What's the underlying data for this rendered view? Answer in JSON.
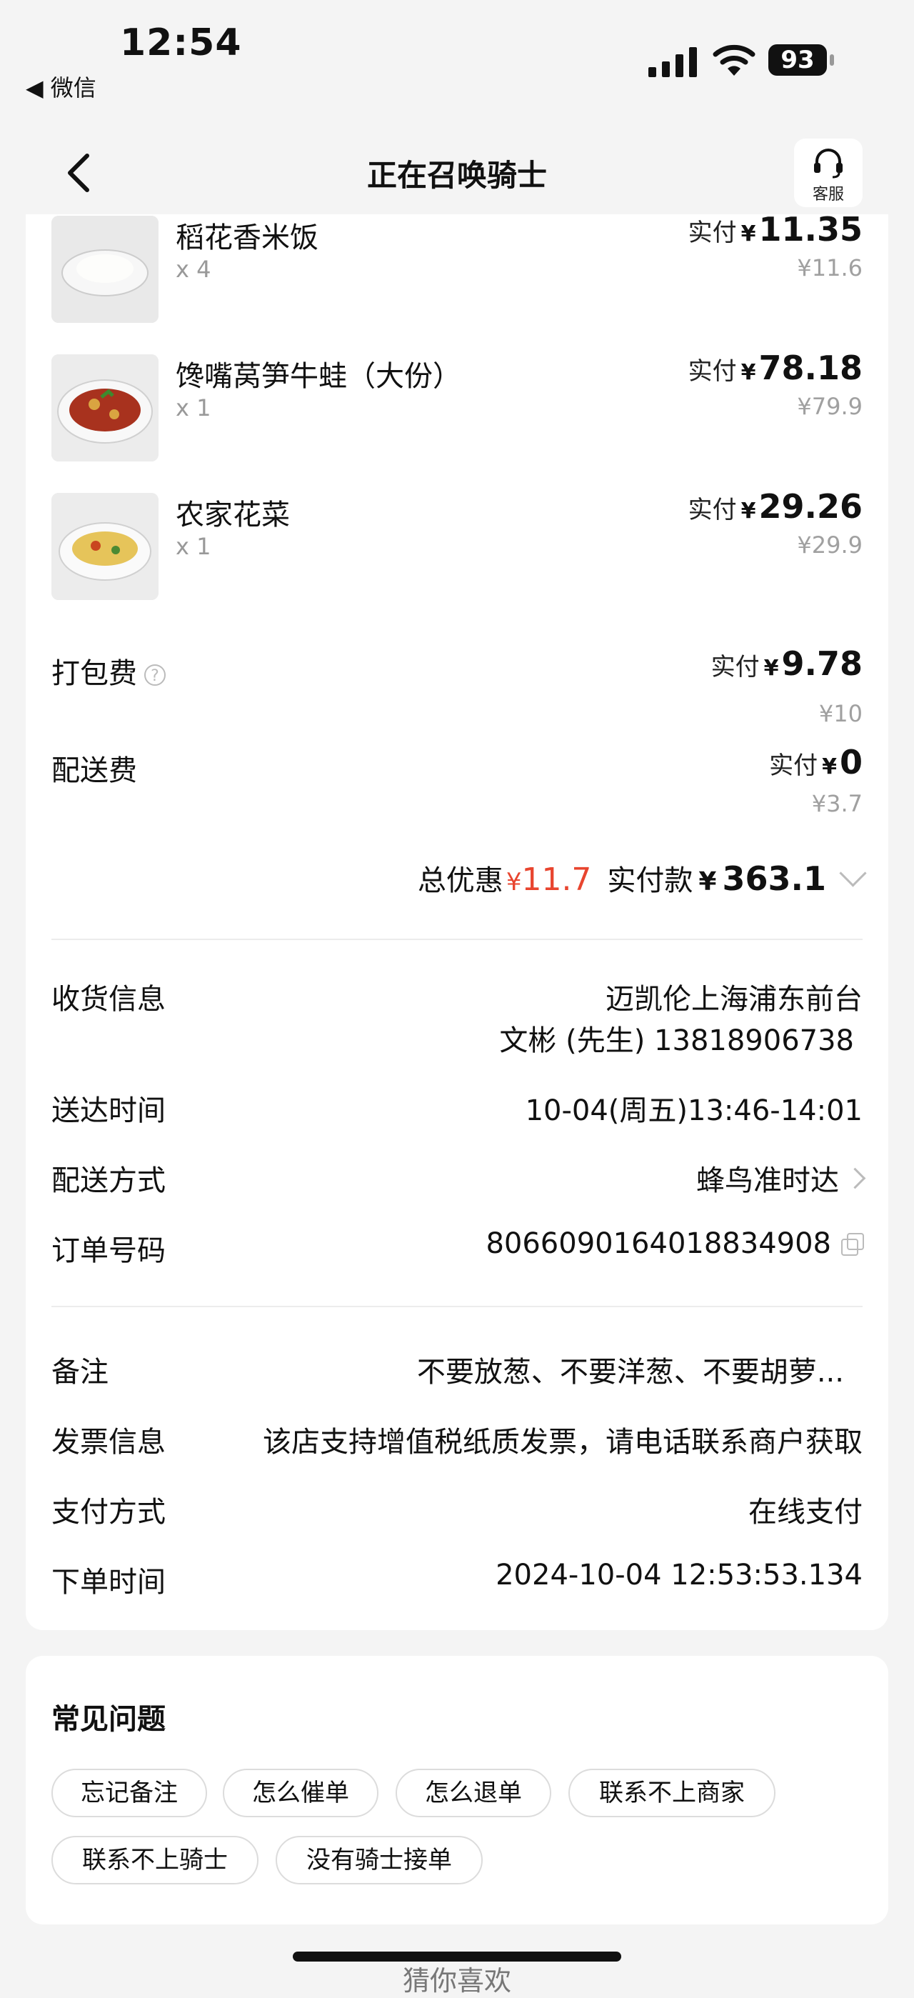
{
  "status_bar": {
    "time": "12:54",
    "back_app": "◀ 微信",
    "battery": "93"
  },
  "nav": {
    "title": "正在召唤骑士",
    "service_label": "客服"
  },
  "items": [
    {
      "name": "稻花香米饭",
      "qty": "x 4",
      "paid_label": "实付",
      "yen": "¥",
      "paid": "11.35",
      "original": "¥11.6"
    },
    {
      "name": "馋嘴莴笋牛蛙（大份）",
      "qty": "x 1",
      "paid_label": "实付",
      "yen": "¥",
      "paid": "78.18",
      "original": "¥79.9"
    },
    {
      "name": "农家花菜",
      "qty": "x 1",
      "paid_label": "实付",
      "yen": "¥",
      "paid": "29.26",
      "original": "¥29.9"
    }
  ],
  "fees": {
    "packing": {
      "label": "打包费",
      "paid_label": "实付",
      "yen": "¥",
      "paid": "9.78",
      "original": "¥10"
    },
    "delivery": {
      "label": "配送费",
      "paid_label": "实付",
      "yen": "¥",
      "paid": "0",
      "original": "¥3.7"
    }
  },
  "summary": {
    "discount_label": "总优惠",
    "discount_yen": "¥",
    "discount": "11.7",
    "paid_label": "实付款",
    "paid_yen": "¥",
    "paid_total": "363.1"
  },
  "info": {
    "address_label": "收货信息",
    "address_line1": "迈凯伦上海浦东前台",
    "address_line2": "文彬 (先生) 13818906738",
    "time_label": "送达时间",
    "time_value": "10-04(周五)13:46-14:01",
    "method_label": "配送方式",
    "method_value": "蜂鸟准时达",
    "order_label": "订单号码",
    "order_value": "8066090164018834908",
    "note_label": "备注",
    "note_value": "不要放葱、不要洋葱、不要胡萝...",
    "invoice_label": "发票信息",
    "invoice_value": "该店支持增值税纸质发票，请电话联系商户获取",
    "payment_label": "支付方式",
    "payment_value": "在线支付",
    "order_time_label": "下单时间",
    "order_time_value": "2024-10-04 12:53:53.134"
  },
  "faq": {
    "title": "常见问题",
    "chips": [
      "忘记备注",
      "怎么催单",
      "怎么退单",
      "联系不上商家",
      "联系不上骑士",
      "没有骑士接单"
    ]
  },
  "bottom": {
    "guess_label": "猜你喜欢"
  },
  "colors": {
    "discount": "#e8452f",
    "background": "#f4f4f4",
    "muted": "#a0a0a0"
  }
}
